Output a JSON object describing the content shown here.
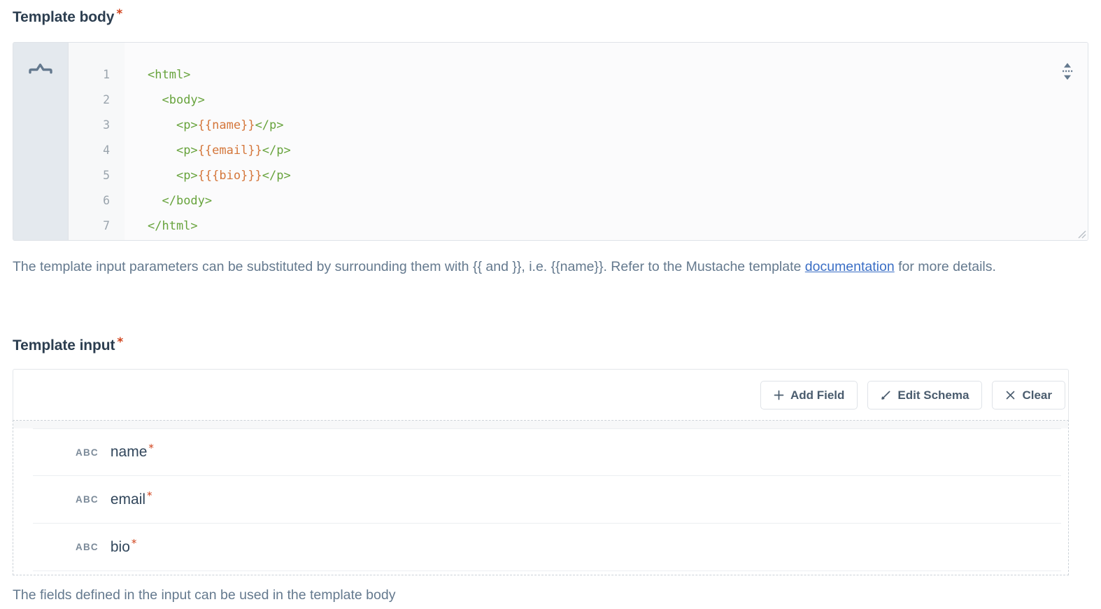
{
  "template_body": {
    "label": "Template body",
    "required_marker": "*",
    "fold_icon": "code-fold-icon",
    "resize_icon": "vertical-resize-icon",
    "grip_icon": "resize-grip-icon",
    "line_numbers": [
      "1",
      "2",
      "3",
      "4",
      "5",
      "6",
      "7"
    ],
    "code_lines": [
      {
        "indent": "",
        "segments": [
          {
            "text": "<html>",
            "type": "tag"
          }
        ]
      },
      {
        "indent": "  ",
        "segments": [
          {
            "text": "<body>",
            "type": "tag"
          }
        ]
      },
      {
        "indent": "    ",
        "segments": [
          {
            "text": "<p>",
            "type": "tag"
          },
          {
            "text": "{{name}}",
            "type": "var"
          },
          {
            "text": "</p>",
            "type": "tag"
          }
        ]
      },
      {
        "indent": "    ",
        "segments": [
          {
            "text": "<p>",
            "type": "tag"
          },
          {
            "text": "{{email}}",
            "type": "var"
          },
          {
            "text": "</p>",
            "type": "tag"
          }
        ]
      },
      {
        "indent": "    ",
        "segments": [
          {
            "text": "<p>",
            "type": "tag"
          },
          {
            "text": "{{{bio}}}",
            "type": "var"
          },
          {
            "text": "</p>",
            "type": "tag"
          }
        ]
      },
      {
        "indent": "  ",
        "segments": [
          {
            "text": "</body>",
            "type": "tag"
          }
        ]
      },
      {
        "indent": "",
        "segments": [
          {
            "text": "</html>",
            "type": "tag"
          }
        ]
      }
    ],
    "help_text_before": "The template input parameters can be substituted by surrounding them with {{ and }}, i.e. {{name}}. Refer to the Mustache template ",
    "help_link": "documentation",
    "help_text_after": " for more details."
  },
  "template_input": {
    "label": "Template input",
    "required_marker": "*",
    "toolbar": [
      {
        "id": "add-field",
        "icon": "plus-icon",
        "label": "Add Field"
      },
      {
        "id": "edit-schema",
        "icon": "pencil-icon",
        "label": "Edit Schema"
      },
      {
        "id": "clear",
        "icon": "close-icon",
        "label": "Clear"
      }
    ],
    "fields": [
      {
        "type_label": "ABC",
        "type": "string",
        "name": "name",
        "required_marker": "*"
      },
      {
        "type_label": "ABC",
        "type": "string",
        "name": "email",
        "required_marker": "*"
      },
      {
        "type_label": "ABC",
        "type": "string",
        "name": "bio",
        "required_marker": "*"
      }
    ],
    "footer_note": "The fields defined in the input can be used in the template body"
  },
  "colors": {
    "heading": "#2c3e50",
    "required_star": "#d0421b",
    "body_text": "#64798e",
    "link": "#3a6ec5",
    "code_tag": "#67a33c",
    "code_var": "#d4763a",
    "editor_bg": "#fbfbfc",
    "gutter_bg": "#e4e9ee",
    "border": "#dfe3e8"
  }
}
